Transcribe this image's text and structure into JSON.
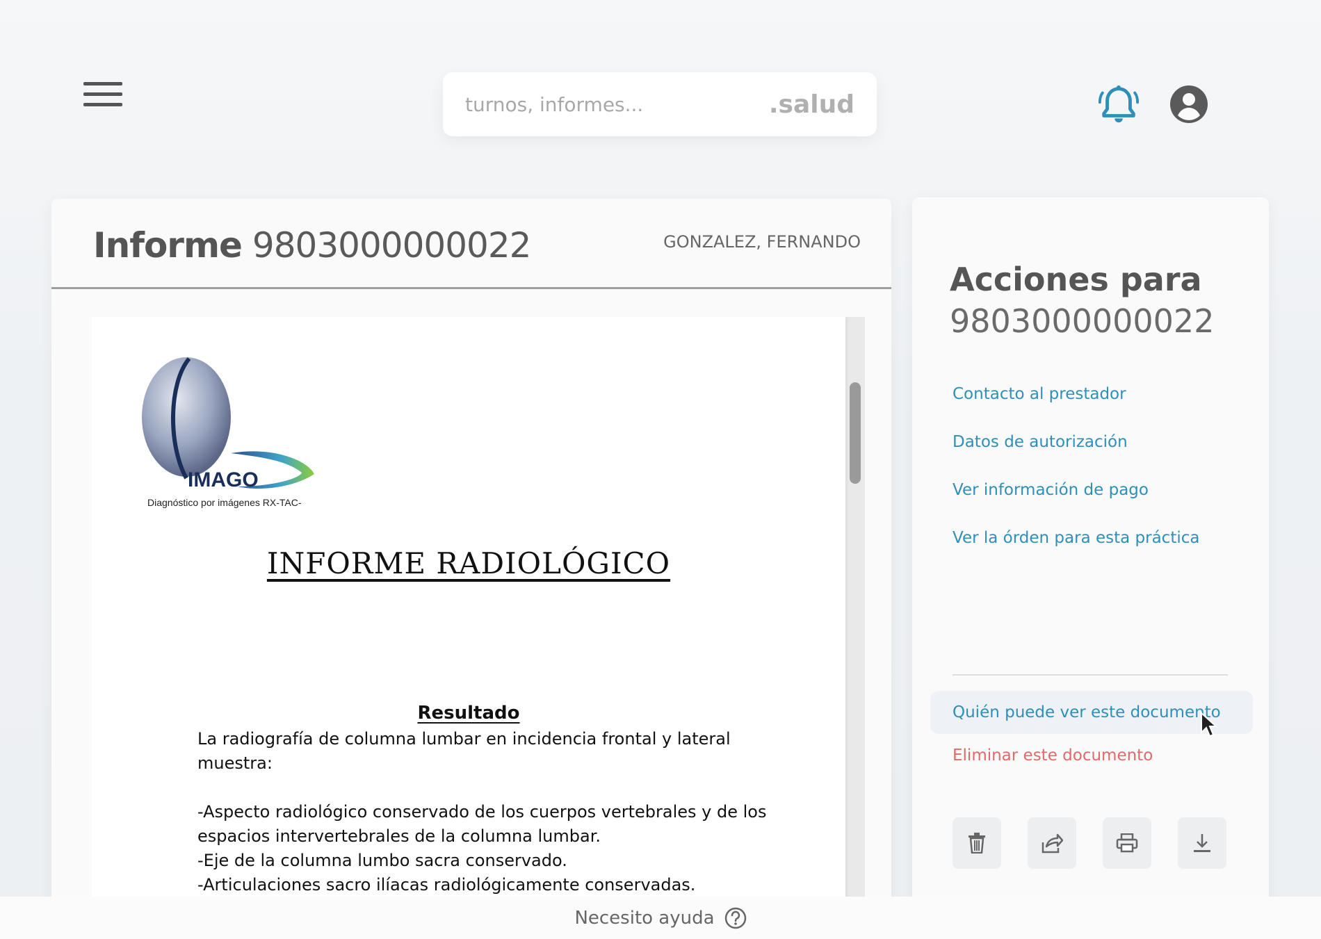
{
  "header": {
    "search_placeholder": "turnos, informes...",
    "search_suffix": ".salud"
  },
  "document": {
    "title_label": "Informe",
    "title_number": "9803000000022",
    "patient_name": "GONZALEZ, FERNANDO",
    "report": {
      "logo_text": "IMAGO",
      "logo_subtitle": "Diagnóstico por imágenes RX-TAC-",
      "title": "INFORME RADIOLÓGICO",
      "result_heading": "Resultado",
      "intro": "La radiografía de columna lumbar en incidencia frontal y lateral muestra:",
      "findings": [
        "-Aspecto radiológico conservado de los cuerpos vertebrales y de los espacios intervertebrales de la columna lumbar.",
        "-Eje de la columna lumbo sacra conservado.",
        "-Articulaciones sacro ilíacas radiológicamente conservadas."
      ]
    }
  },
  "actions": {
    "title_line1": "Acciones para",
    "title_line2": "9803000000022",
    "links": [
      "Contacto al prestador",
      "Datos de autorización",
      "Ver información de pago",
      "Ver la órden para esta práctica"
    ],
    "who_can_see": "Quién puede ver este documento",
    "delete": "Eliminar este documento",
    "icon_buttons": [
      "trash-icon",
      "share-icon",
      "print-icon",
      "download-icon"
    ]
  },
  "footer": {
    "help_text": "Necesito ayuda"
  },
  "colors": {
    "link": "#2e8fb8",
    "danger": "#e06a6a",
    "bell": "#2e8fb8"
  }
}
